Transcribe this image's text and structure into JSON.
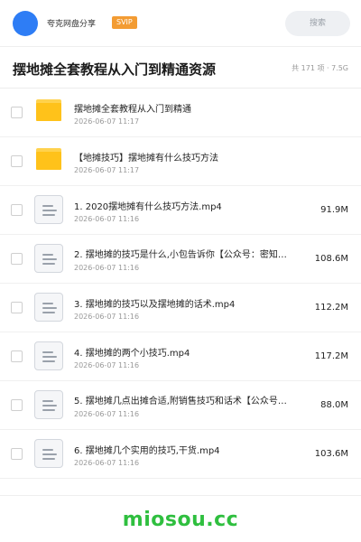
{
  "header": {
    "share_name": "夸克网盘分享",
    "badge": "SVIP",
    "search_placeholder": "搜索"
  },
  "title_bar": {
    "title": "摆地摊全套教程从入门到精通资源",
    "summary": "共 171 项 · 7.5G"
  },
  "files": [
    {
      "type": "folder",
      "name": "摆地摊全套教程从入门到精通",
      "date": "2026-06-07 11:17",
      "size": ""
    },
    {
      "type": "folder",
      "name": "【地摊技巧】摆地摊有什么技巧方法",
      "date": "2026-06-07 11:17",
      "size": ""
    },
    {
      "type": "video",
      "name": "1. 2020摆地摊有什么技巧方法.mp4",
      "date": "2026-06-07 11:16",
      "size": "91.9M"
    },
    {
      "type": "video",
      "name": "2. 摆地摊的技巧是什么,小包告诉你【公众号：密知…",
      "date": "2026-06-07 11:16",
      "size": "108.6M"
    },
    {
      "type": "video",
      "name": "3. 摆地摊的技巧以及摆地摊的话术.mp4",
      "date": "2026-06-07 11:16",
      "size": "112.2M"
    },
    {
      "type": "video",
      "name": "4. 摆地摊的两个小技巧.mp4",
      "date": "2026-06-07 11:16",
      "size": "117.2M"
    },
    {
      "type": "video",
      "name": "5. 摆地摊几点出摊合适,附销售技巧和话术【公众号…",
      "date": "2026-06-07 11:16",
      "size": "88.0M"
    },
    {
      "type": "video",
      "name": "6. 摆地摊几个实用的技巧,干货.mp4",
      "date": "2026-06-07 11:16",
      "size": "103.6M"
    }
  ],
  "footer": {
    "watermark": "miosou.cc"
  },
  "colors": {
    "accent": "#2e7df5",
    "svip": "#f39c33",
    "folder": "#ffc21a",
    "watermark": "#2fbf3f"
  },
  "icons": {
    "folder": "folder-icon",
    "video": "video-file-icon"
  }
}
